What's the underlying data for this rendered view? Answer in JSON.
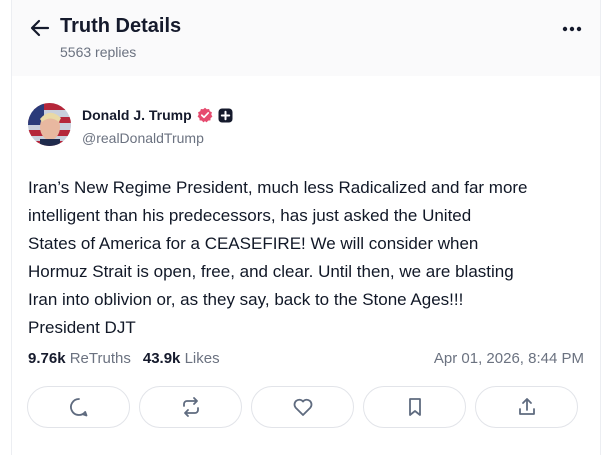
{
  "header": {
    "title": "Truth Details",
    "replies_count": "5563 replies"
  },
  "author": {
    "name": "Donald J. Trump",
    "handle": "@realDonaldTrump",
    "verified_color": "#e64b6f"
  },
  "post": {
    "text": "Iran’s New Regime President, much less Radicalized and far more\nintelligent than his predecessors, has just asked the United\nStates of America for a CEASEFIRE! We will consider when\nHormuz Strait is open, free, and clear. Until then, we are blasting\nIran into oblivion or, as they say, back to the Stone Ages!!!\nPresident DJT",
    "retruths_count": "9.76k",
    "retruths_label": "ReTruths",
    "likes_count": "43.9k",
    "likes_label": "Likes",
    "timestamp": "Apr 01, 2026, 8:44 PM"
  },
  "actions": [
    {
      "icon": "reply-icon"
    },
    {
      "icon": "retruth-icon"
    },
    {
      "icon": "like-icon"
    },
    {
      "icon": "bookmark-icon"
    },
    {
      "icon": "share-icon"
    }
  ],
  "colors": {
    "text": "#111827",
    "muted": "#6b7280",
    "border": "#e2e4e9",
    "icon": "#5f6b7f"
  }
}
